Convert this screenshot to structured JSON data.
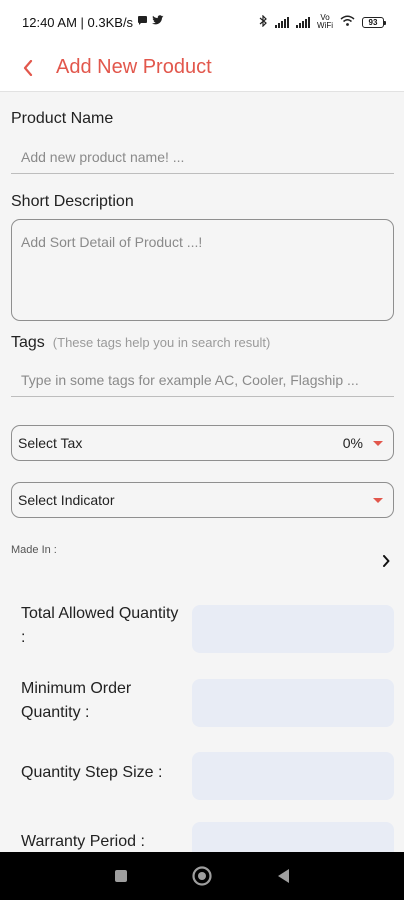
{
  "status_bar": {
    "time_and_speed": "12:40 AM | 0.3KB/s",
    "network_label": "Vo WiFi",
    "battery": "93"
  },
  "header": {
    "title": "Add New Product"
  },
  "form": {
    "product_name": {
      "label": "Product Name",
      "placeholder": "Add new product name! ..."
    },
    "short_description": {
      "label": "Short Description",
      "placeholder": "Add Sort Detail of Product ...!"
    },
    "tags": {
      "label": "Tags",
      "hint": "(These tags help you in search result)",
      "placeholder": "Type in some tags for example AC, Cooler, Flagship ..."
    },
    "tax": {
      "label": "Select Tax",
      "value": "0%"
    },
    "indicator": {
      "label": "Select Indicator"
    },
    "made_in": {
      "label": "Made In :"
    },
    "total_allowed_quantity": {
      "label": "Total Allowed Quantity :"
    },
    "minimum_order_quantity": {
      "label": "Minimum Order Quantity :"
    },
    "quantity_step_size": {
      "label": "Quantity Step Size :"
    },
    "warranty_period": {
      "label": "Warranty Period :"
    }
  },
  "colors": {
    "accent": "#e2574c",
    "input_fill": "#e8ecf5",
    "background": "#f5f5f5"
  },
  "icons": {
    "back": "chevron-left-icon",
    "made_in_arrow": "chevron-right-icon",
    "dropdown": "caret-down-icon",
    "nav_recent": "square-icon",
    "nav_home": "circle-icon",
    "nav_back": "triangle-icon"
  }
}
